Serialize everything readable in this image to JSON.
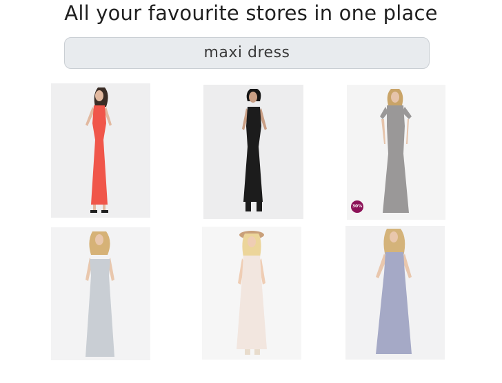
{
  "header": {
    "title": "All your favourite stores in one place"
  },
  "search": {
    "value": "maxi dress"
  },
  "products": [
    {
      "name": "red maxi dress",
      "dress_color": "#f0564a",
      "bg": "#efeff0"
    },
    {
      "name": "black maxi dress",
      "dress_color": "#1c1c1c",
      "bg": "#ededee"
    },
    {
      "name": "grey t-shirt maxi dress",
      "dress_color": "#9a9898",
      "bg": "#f4f4f4",
      "badge": "30%"
    },
    {
      "name": "grey strapless maxi dress",
      "dress_color": "#c9ced4",
      "bg": "#f3f3f4"
    },
    {
      "name": "white maxi dress",
      "dress_color": "#f2e6df",
      "bg": "#f6f6f6"
    },
    {
      "name": "lilac draped maxi dress",
      "dress_color": "#a5a9c6",
      "bg": "#f2f2f3"
    }
  ]
}
